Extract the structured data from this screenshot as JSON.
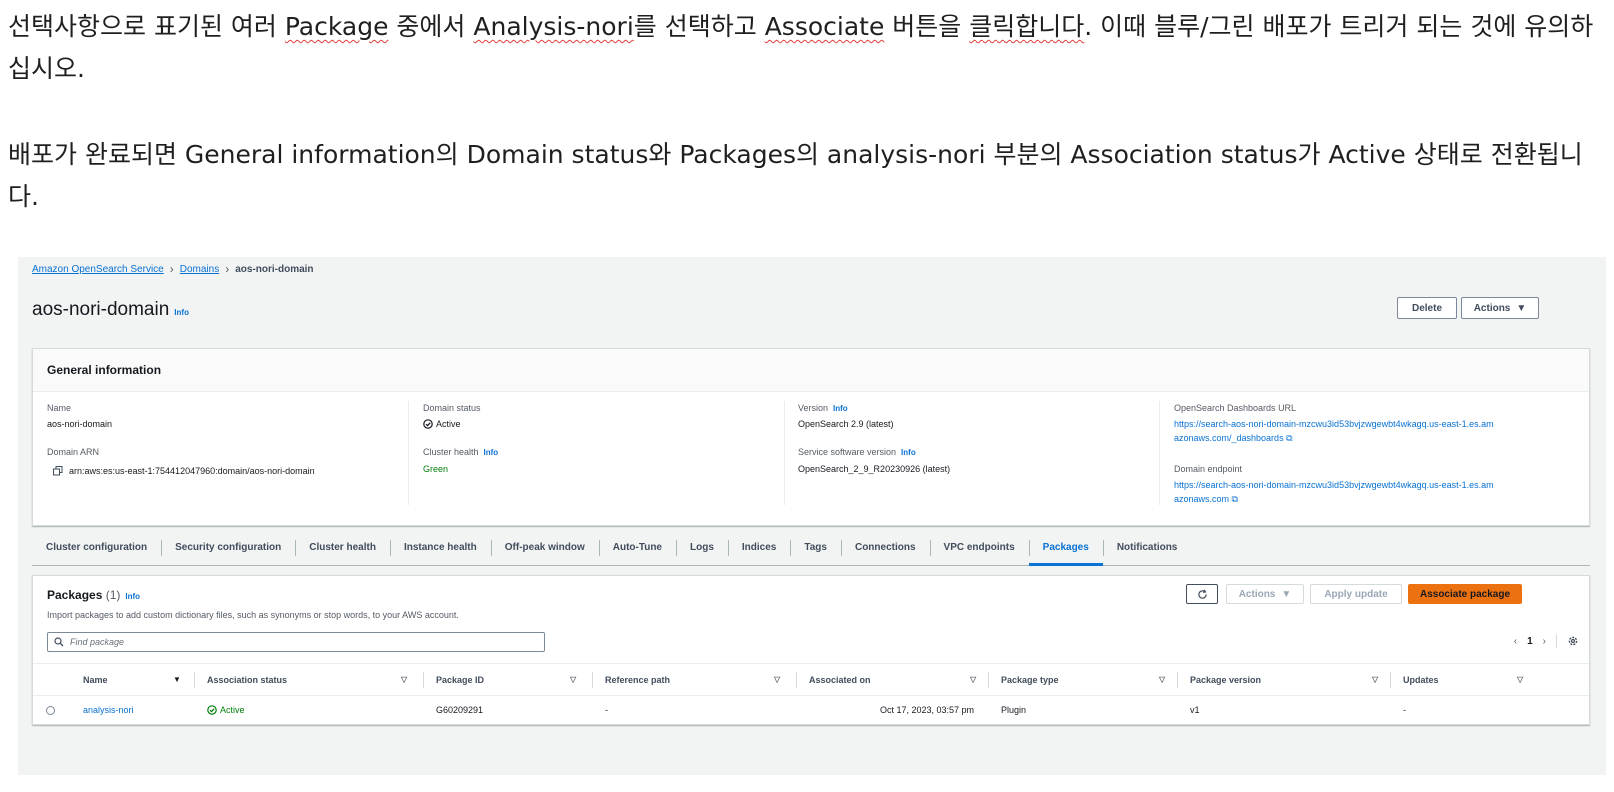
{
  "instructions": {
    "p1_pre": "선택사항으로 표기된 여러 ",
    "p1_w1": "Package",
    "p1_mid1": " 중에서 ",
    "p1_w2": "Analysis-nori",
    "p1_mid2": "를 선택하고 ",
    "p1_w3": "Associate",
    "p1_mid3": " 버튼을 ",
    "p1_w4": "클릭합니다",
    "p1_post": ". 이때 블루/그린 배포가 트리거 되는 것에 유의하십시오.",
    "p2": "배포가 완료되면 General information의 Domain status와 Packages의 analysis-nori 부분의 Association status가 Active 상태로 전환됩니다."
  },
  "breadcrumb": {
    "service": "Amazon OpenSearch Service",
    "domains": "Domains",
    "current": "aos-nori-domain"
  },
  "page": {
    "title": "aos-nori-domain",
    "info": "Info",
    "delete": "Delete",
    "actions": "Actions"
  },
  "general": {
    "heading": "General information",
    "name_label": "Name",
    "name_value": "aos-nori-domain",
    "arn_label": "Domain ARN",
    "arn_value": "arn:aws:es:us-east-1:754412047960:domain/aos-nori-domain",
    "status_label": "Domain status",
    "status_value": "Active",
    "health_label": "Cluster health",
    "health_info": "Info",
    "health_value": "Green",
    "version_label": "Version",
    "version_info": "Info",
    "version_value": "OpenSearch 2.9 (latest)",
    "ssv_label": "Service software version",
    "ssv_info": "Info",
    "ssv_value": "OpenSearch_2_9_R20230926 (latest)",
    "dash_label": "OpenSearch Dashboards URL",
    "dash_value": "https://search-aos-nori-domain-mzcwu3id53bvjzwgewbt4wkagq.us-east-1.es.amazonaws.com/_dashboards",
    "endpoint_label": "Domain endpoint",
    "endpoint_value": "https://search-aos-nori-domain-mzcwu3id53bvjzwgewbt4wkagq.us-east-1.es.amazonaws.com"
  },
  "tabs": [
    "Cluster configuration",
    "Security configuration",
    "Cluster health",
    "Instance health",
    "Off-peak window",
    "Auto-Tune",
    "Logs",
    "Indices",
    "Tags",
    "Connections",
    "VPC endpoints",
    "Packages",
    "Notifications"
  ],
  "active_tab": "Packages",
  "packages": {
    "title": "Packages",
    "count": "(1)",
    "info": "Info",
    "description": "Import packages to add custom dictionary files, such as synonyms or stop words, to your AWS account.",
    "search_placeholder": "Find package",
    "actions": "Actions",
    "apply_update": "Apply update",
    "associate": "Associate package",
    "page": "1",
    "columns": [
      "Name",
      "Association status",
      "Package ID",
      "Reference path",
      "Associated on",
      "Package type",
      "Package version",
      "Updates"
    ],
    "rows": [
      {
        "name": "analysis-nori",
        "status": "Active",
        "package_id": "G60209291",
        "reference_path": "-",
        "associated_on": "Oct 17, 2023, 03:57 pm",
        "type": "Plugin",
        "version": "v1",
        "updates": "-"
      }
    ]
  },
  "colors": {
    "link": "#0972d3",
    "primary": "#ec7211",
    "success": "#037f0c"
  }
}
